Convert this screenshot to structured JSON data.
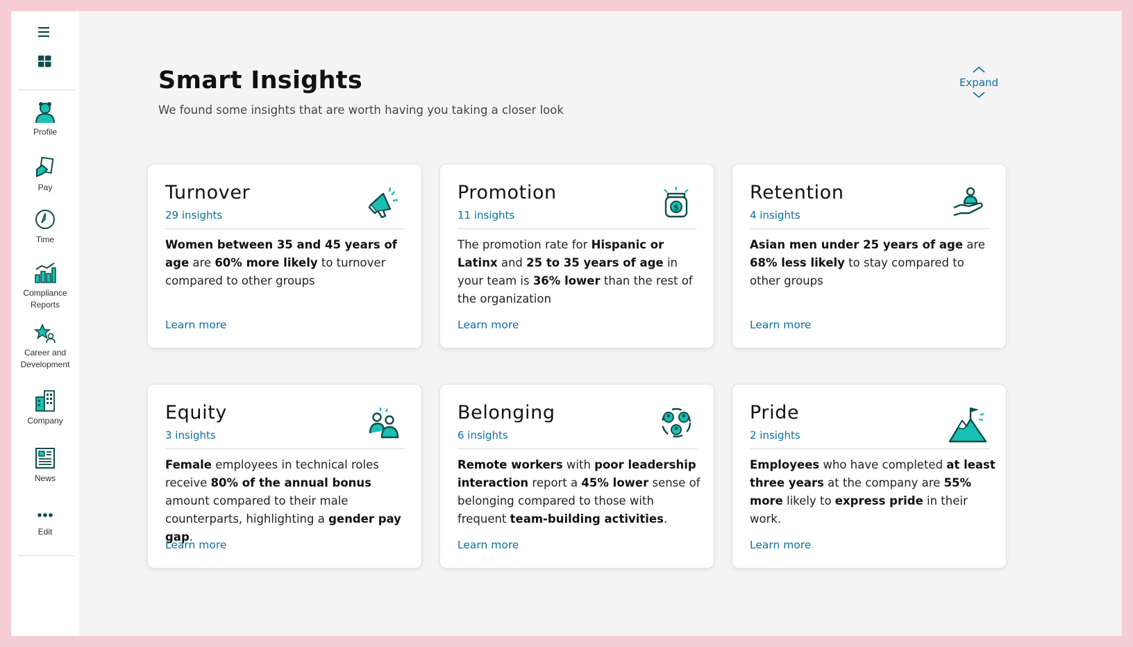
{
  "colors": {
    "accent": "#1bbfb3",
    "dark": "#0d4d4a",
    "link": "#0b6ea6",
    "frame": "#f7cdd4"
  },
  "sidebar": {
    "top_icons": [
      "hamburger-menu-icon",
      "apps-grid-icon"
    ],
    "items": [
      {
        "label": "Profile",
        "icon": "person-icon"
      },
      {
        "label": "Pay",
        "icon": "pay-icon"
      },
      {
        "label": "Time",
        "icon": "clock-icon"
      },
      {
        "label": "Compliance Reports",
        "icon": "bar-chart-icon"
      },
      {
        "label": "Career and Development",
        "icon": "star-person-icon"
      },
      {
        "label": "Company",
        "icon": "building-icon"
      },
      {
        "label": "News",
        "icon": "newspaper-icon"
      },
      {
        "label": "Edit",
        "icon": "more-dots-icon"
      }
    ]
  },
  "header": {
    "title": "Smart Insights",
    "subtitle": "We found some insights that are worth having you taking a closer look",
    "expand_label": "Expand"
  },
  "cards": [
    {
      "title": "Turnover",
      "count": "29 insights",
      "icon": "megaphone-icon",
      "body": [
        [
          "b",
          "Women between 35 and 45 years of age"
        ],
        [
          "t",
          " are "
        ],
        [
          "b",
          "60% more likely"
        ],
        [
          "t",
          " to turnover compared to other groups"
        ]
      ],
      "link": "Learn more"
    },
    {
      "title": "Promotion",
      "count": "11 insights",
      "icon": "money-jar-icon",
      "body": [
        [
          "t",
          "The promotion rate for "
        ],
        [
          "b",
          "Hispanic or Latinx"
        ],
        [
          "t",
          " and "
        ],
        [
          "b",
          "25 to 35 years of age"
        ],
        [
          "t",
          "  in your team is "
        ],
        [
          "b",
          "36% lower"
        ],
        [
          "t",
          " than the rest of the organization"
        ]
      ],
      "link": "Learn more"
    },
    {
      "title": "Retention",
      "count": "4 insights",
      "icon": "hand-person-icon",
      "body": [
        [
          "b",
          "Asian men under 25 years of age"
        ],
        [
          "t",
          " are "
        ],
        [
          "b",
          "68% less likely"
        ],
        [
          "t",
          " to stay compared to other groups"
        ]
      ],
      "link": "Learn more"
    },
    {
      "title": "Equity",
      "count": "3 insights",
      "icon": "two-people-icon",
      "body": [
        [
          "b",
          "Female"
        ],
        [
          "t",
          " employees in technical roles receive "
        ],
        [
          "b",
          "80% of the annual bonus"
        ],
        [
          "t",
          " amount compared to their male counterparts, highlighting a "
        ],
        [
          "b",
          "gender pay gap"
        ],
        [
          "t",
          "."
        ]
      ],
      "link": "Learn more"
    },
    {
      "title": "Belonging",
      "count": "6 insights",
      "icon": "group-circle-icon",
      "body": [
        [
          "b",
          "Remote workers"
        ],
        [
          "t",
          " with "
        ],
        [
          "b",
          "poor leadership interaction"
        ],
        [
          "t",
          " report a "
        ],
        [
          "b",
          "45% lower"
        ],
        [
          "t",
          " sense of belonging compared to those with frequent "
        ],
        [
          "b",
          "team-building activities"
        ],
        [
          "t",
          "."
        ]
      ],
      "link": "Learn more"
    },
    {
      "title": "Pride",
      "count": "2 insights",
      "icon": "mountain-flag-icon",
      "body": [
        [
          "b",
          "Employees"
        ],
        [
          "t",
          " who have completed "
        ],
        [
          "b",
          "at least three years"
        ],
        [
          "t",
          " at the company are "
        ],
        [
          "b",
          "55% more"
        ],
        [
          "t",
          " likely to "
        ],
        [
          "b",
          "express pride"
        ],
        [
          "t",
          " in their work."
        ]
      ],
      "link": "Learn more"
    }
  ]
}
